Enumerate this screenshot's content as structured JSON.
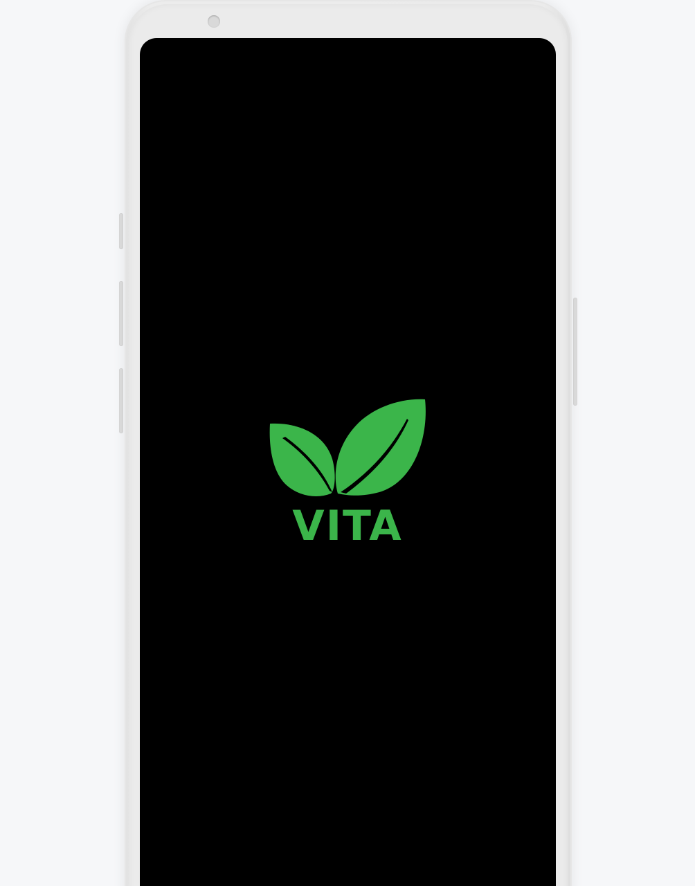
{
  "app": {
    "brand_name": "VITA",
    "logo_icon": "two-leaves-icon"
  },
  "colors": {
    "brand_green": "#3bb54a",
    "screen_background": "#000000",
    "page_background": "#f6f7f9",
    "device_frame": "#ebebeb"
  }
}
